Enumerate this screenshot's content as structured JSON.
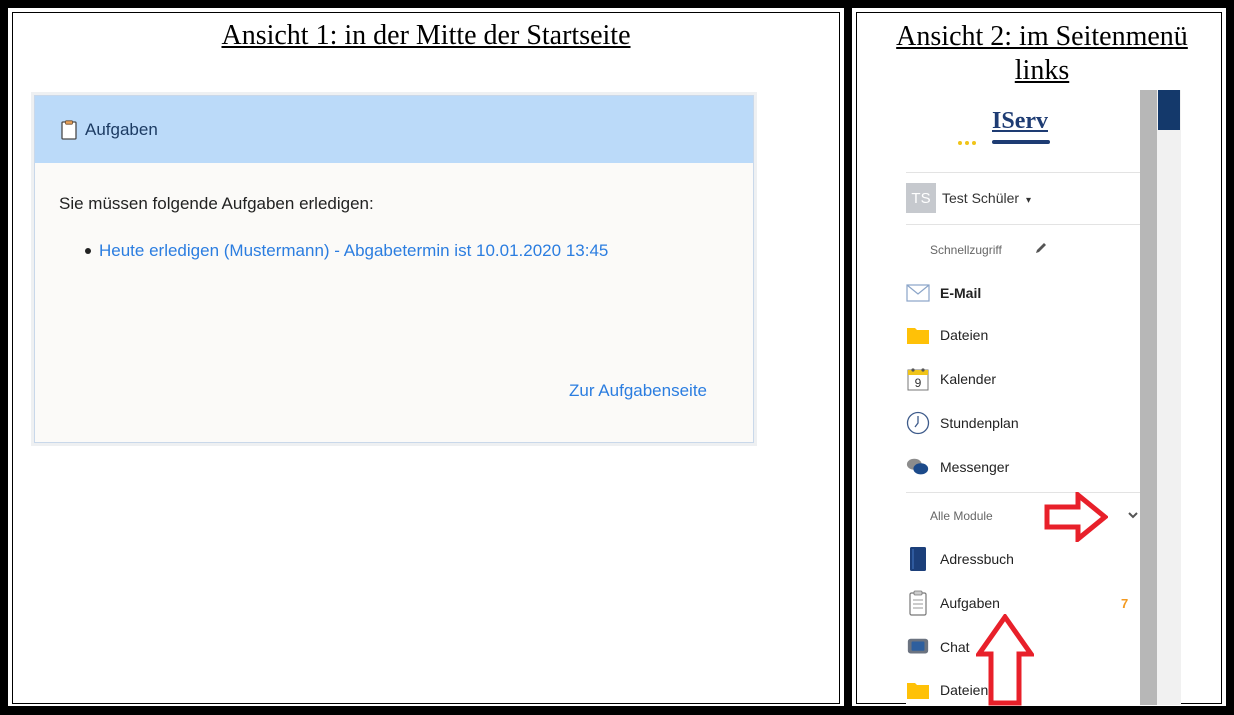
{
  "panel1": {
    "title": "Ansicht 1: in der Mitte der Startseite",
    "widget": {
      "title": "Aufgaben",
      "icon": "clipboard-icon",
      "intro": "Sie müssen folgende Aufgaben erledigen:",
      "tasks": [
        {
          "text": "Heute erledigen (Mustermann) - Abgabetermin ist 10.01.2020 13:45"
        }
      ],
      "footer_link": "Zur Aufgabenseite"
    }
  },
  "panel2": {
    "title": "Ansicht 2: im Seitenmenü links",
    "logo_text": "IServ",
    "user": {
      "initials": "TS",
      "name": "Test Schüler"
    },
    "quick_access_label": "Schnellzugriff",
    "quick_items": [
      {
        "label": "E-Mail",
        "icon": "mail-icon",
        "bold": true
      },
      {
        "label": "Dateien",
        "icon": "folder-icon"
      },
      {
        "label": "Kalender",
        "icon": "calendar-icon",
        "day": "9"
      },
      {
        "label": "Stundenplan",
        "icon": "clock-icon"
      },
      {
        "label": "Messenger",
        "icon": "chat-bubbles-icon"
      }
    ],
    "all_modules_label": "Alle Module",
    "module_items": [
      {
        "label": "Adressbuch",
        "icon": "addressbook-icon"
      },
      {
        "label": "Aufgaben",
        "icon": "clipboard-icon",
        "badge": "7"
      },
      {
        "label": "Chat",
        "icon": "chat-icon"
      },
      {
        "label": "Dateien",
        "icon": "folder-icon"
      }
    ],
    "accent_color": "#e8202a"
  }
}
